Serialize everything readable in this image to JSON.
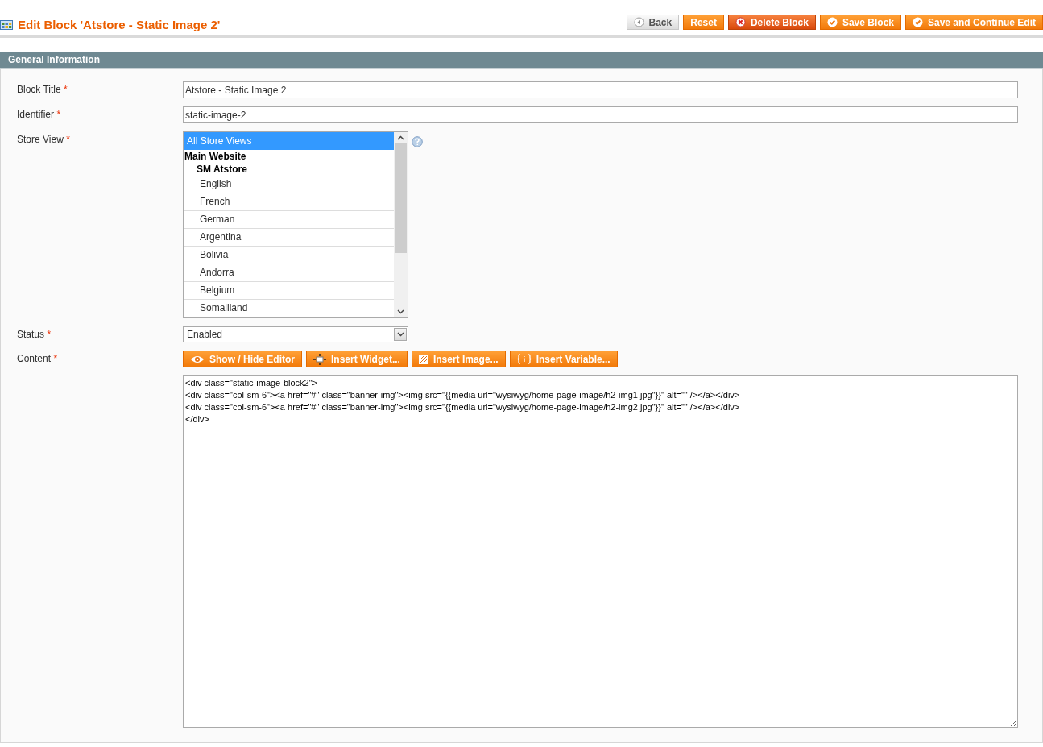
{
  "header": {
    "title": "Edit Block 'Atstore - Static Image 2'",
    "buttons": [
      {
        "label": "Back",
        "kind": "back"
      },
      {
        "label": "Reset",
        "kind": "reset"
      },
      {
        "label": "Delete Block",
        "kind": "delete"
      },
      {
        "label": "Save Block",
        "kind": "save"
      },
      {
        "label": "Save and Continue Edit",
        "kind": "save"
      }
    ]
  },
  "section": {
    "title": "General Information",
    "block_title": {
      "label": "Block Title",
      "required_mark": "*",
      "value": "Atstore - Static Image 2"
    },
    "identifier": {
      "label": "Identifier",
      "required_mark": "*",
      "value": "static-image-2"
    },
    "store_view": {
      "label": "Store View",
      "required_mark": "*",
      "options": [
        {
          "label": "All Store Views",
          "kind": "all",
          "selected": true
        },
        {
          "label": "Main Website",
          "kind": "website",
          "selected": false
        },
        {
          "label": "SM Atstore",
          "kind": "group",
          "selected": false
        },
        {
          "label": "English",
          "kind": "store",
          "selected": false
        },
        {
          "label": "French",
          "kind": "store",
          "selected": false
        },
        {
          "label": "German",
          "kind": "store",
          "selected": false
        },
        {
          "label": "Argentina",
          "kind": "store",
          "selected": false
        },
        {
          "label": "Bolivia",
          "kind": "store",
          "selected": false
        },
        {
          "label": "Andorra",
          "kind": "store",
          "selected": false
        },
        {
          "label": "Belgium",
          "kind": "store",
          "selected": false
        },
        {
          "label": "Somaliland",
          "kind": "store",
          "selected": false
        }
      ]
    },
    "status": {
      "label": "Status",
      "required_mark": "*",
      "value": "Enabled"
    },
    "content": {
      "label": "Content",
      "required_mark": "*",
      "buttons": [
        {
          "label": "Show / Hide Editor",
          "kind": "editor"
        },
        {
          "label": "Insert Widget...",
          "kind": "widget"
        },
        {
          "label": "Insert Image...",
          "kind": "image"
        },
        {
          "label": "Insert Variable...",
          "kind": "variable"
        }
      ],
      "value": "<div class=\"static-image-block2\">\n<div class=\"col-sm-6\"><a href=\"#\" class=\"banner-img\"><img src=\"{{media url=\"wysiwyg/home-page-image/h2-img1.jpg\"}}\" alt=\"\" /></a></div>\n<div class=\"col-sm-6\"><a href=\"#\" class=\"banner-img\"><img src=\"{{media url=\"wysiwyg/home-page-image/h2-img2.jpg\"}}\" alt=\"\" /></a></div>\n</div>"
    }
  }
}
